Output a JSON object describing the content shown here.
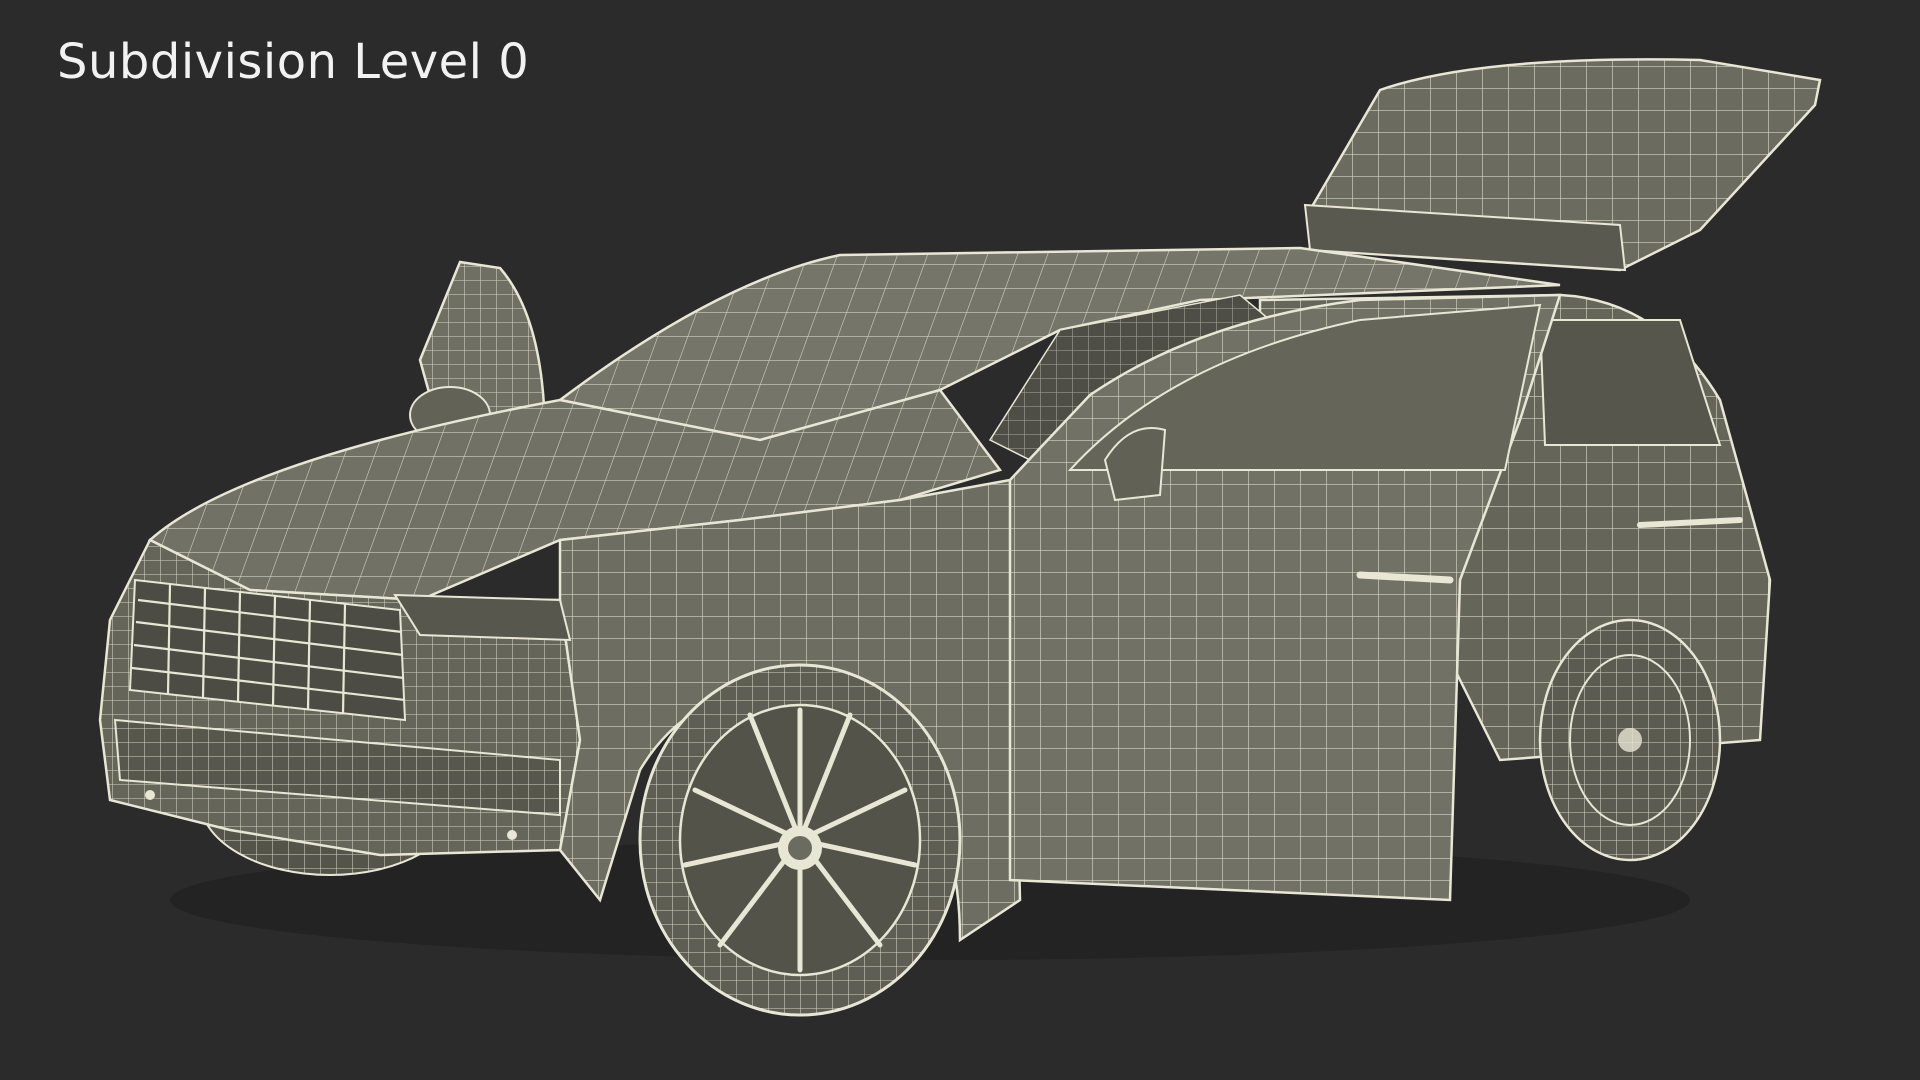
{
  "render": {
    "title": "Subdivision Level 0"
  },
  "colors": {
    "background": "#2b2b2b",
    "title_text": "#f2f2f2",
    "surface": "#6c6b5f",
    "surface_dark": "#4d4c44",
    "surface_light": "#7c7b6e",
    "wireframe": "#e8e6d4"
  },
  "icons": {
    "subject": "suv-wireframe-model"
  }
}
